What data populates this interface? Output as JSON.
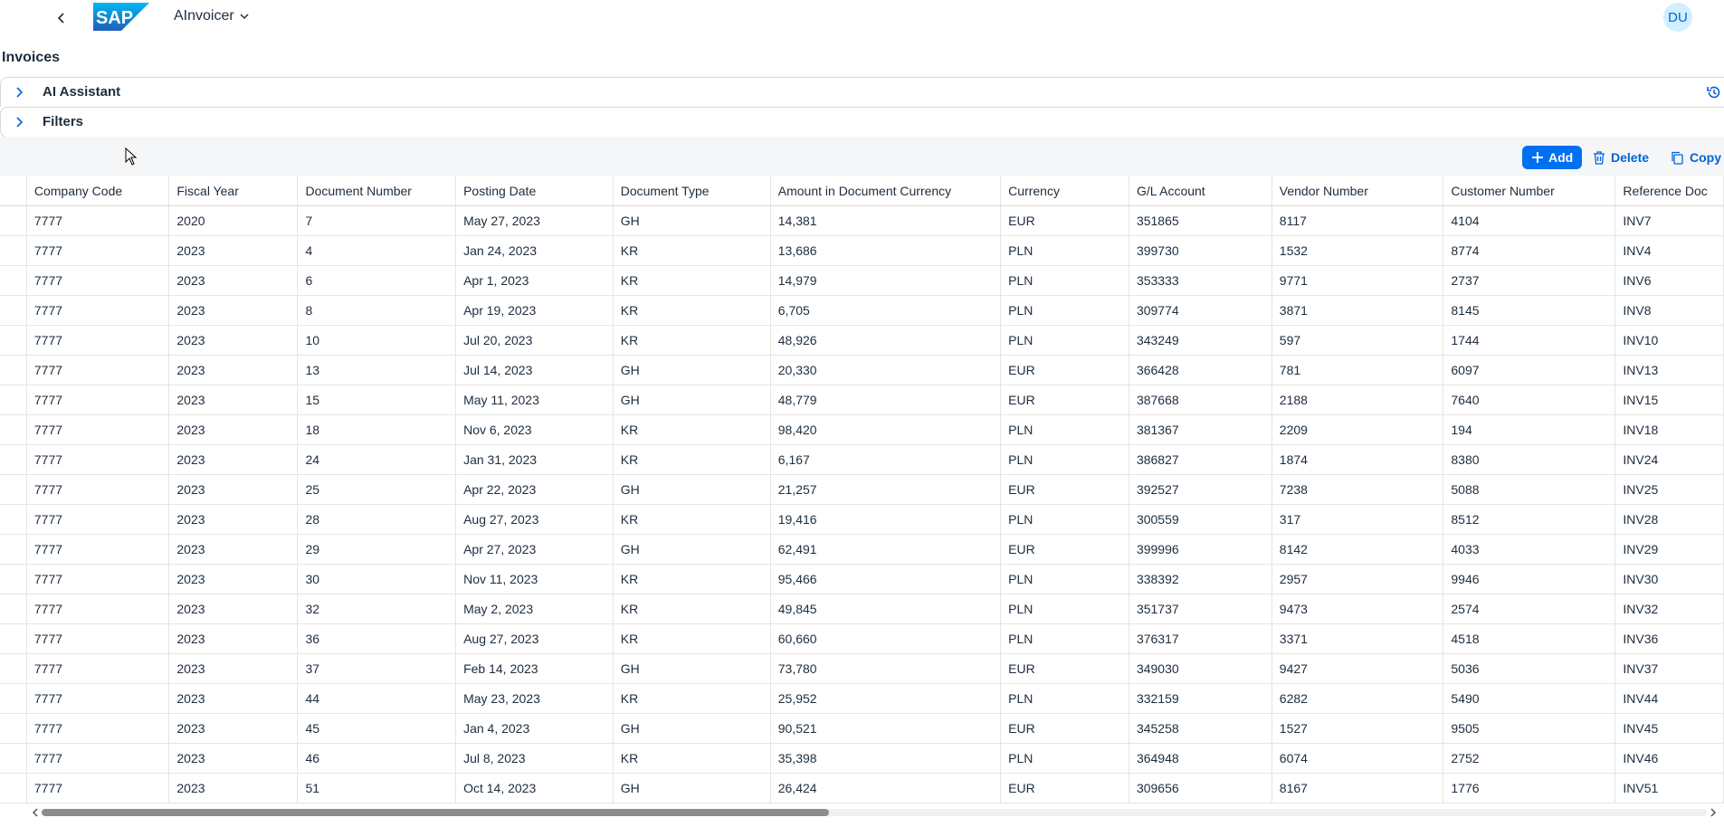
{
  "shell": {
    "app_title": "AInvoicer",
    "avatar_initials": "DU",
    "brand_color": "#0070f2"
  },
  "page": {
    "title": "Invoices"
  },
  "panels": {
    "ai_assistant": "AI Assistant",
    "filters": "Filters"
  },
  "toolbar": {
    "add_label": "Add",
    "delete_label": "Delete",
    "copy_label": "Copy"
  },
  "table": {
    "columns": [
      "Company Code",
      "Fiscal Year",
      "Document Number",
      "Posting Date",
      "Document Type",
      "Amount in Document Currency",
      "Currency",
      "G/L Account",
      "Vendor Number",
      "Customer Number",
      "Reference Doc"
    ],
    "rows": [
      [
        "7777",
        "2020",
        "7",
        "May 27, 2023",
        "GH",
        "14,381",
        "EUR",
        "351865",
        "8117",
        "4104",
        "INV7"
      ],
      [
        "7777",
        "2023",
        "4",
        "Jan 24, 2023",
        "KR",
        "13,686",
        "PLN",
        "399730",
        "1532",
        "8774",
        "INV4"
      ],
      [
        "7777",
        "2023",
        "6",
        "Apr 1, 2023",
        "KR",
        "14,979",
        "PLN",
        "353333",
        "9771",
        "2737",
        "INV6"
      ],
      [
        "7777",
        "2023",
        "8",
        "Apr 19, 2023",
        "KR",
        "6,705",
        "PLN",
        "309774",
        "3871",
        "8145",
        "INV8"
      ],
      [
        "7777",
        "2023",
        "10",
        "Jul 20, 2023",
        "KR",
        "48,926",
        "PLN",
        "343249",
        "597",
        "1744",
        "INV10"
      ],
      [
        "7777",
        "2023",
        "13",
        "Jul 14, 2023",
        "GH",
        "20,330",
        "EUR",
        "366428",
        "781",
        "6097",
        "INV13"
      ],
      [
        "7777",
        "2023",
        "15",
        "May 11, 2023",
        "GH",
        "48,779",
        "EUR",
        "387668",
        "2188",
        "7640",
        "INV15"
      ],
      [
        "7777",
        "2023",
        "18",
        "Nov 6, 2023",
        "KR",
        "98,420",
        "PLN",
        "381367",
        "2209",
        "194",
        "INV18"
      ],
      [
        "7777",
        "2023",
        "24",
        "Jan 31, 2023",
        "KR",
        "6,167",
        "PLN",
        "386827",
        "1874",
        "8380",
        "INV24"
      ],
      [
        "7777",
        "2023",
        "25",
        "Apr 22, 2023",
        "GH",
        "21,257",
        "EUR",
        "392527",
        "7238",
        "5088",
        "INV25"
      ],
      [
        "7777",
        "2023",
        "28",
        "Aug 27, 2023",
        "KR",
        "19,416",
        "PLN",
        "300559",
        "317",
        "8512",
        "INV28"
      ],
      [
        "7777",
        "2023",
        "29",
        "Apr 27, 2023",
        "GH",
        "62,491",
        "EUR",
        "399996",
        "8142",
        "4033",
        "INV29"
      ],
      [
        "7777",
        "2023",
        "30",
        "Nov 11, 2023",
        "KR",
        "95,466",
        "PLN",
        "338392",
        "2957",
        "9946",
        "INV30"
      ],
      [
        "7777",
        "2023",
        "32",
        "May 2, 2023",
        "KR",
        "49,845",
        "PLN",
        "351737",
        "9473",
        "2574",
        "INV32"
      ],
      [
        "7777",
        "2023",
        "36",
        "Aug 27, 2023",
        "KR",
        "60,660",
        "PLN",
        "376317",
        "3371",
        "4518",
        "INV36"
      ],
      [
        "7777",
        "2023",
        "37",
        "Feb 14, 2023",
        "GH",
        "73,780",
        "EUR",
        "349030",
        "9427",
        "5036",
        "INV37"
      ],
      [
        "7777",
        "2023",
        "44",
        "May 23, 2023",
        "KR",
        "25,952",
        "PLN",
        "332159",
        "6282",
        "5490",
        "INV44"
      ],
      [
        "7777",
        "2023",
        "45",
        "Jan 4, 2023",
        "GH",
        "90,521",
        "EUR",
        "345258",
        "1527",
        "9505",
        "INV45"
      ],
      [
        "7777",
        "2023",
        "46",
        "Jul 8, 2023",
        "KR",
        "35,398",
        "PLN",
        "364948",
        "6074",
        "2752",
        "INV46"
      ],
      [
        "7777",
        "2023",
        "51",
        "Oct 14, 2023",
        "GH",
        "26,424",
        "EUR",
        "309656",
        "8167",
        "1776",
        "INV51"
      ]
    ]
  }
}
